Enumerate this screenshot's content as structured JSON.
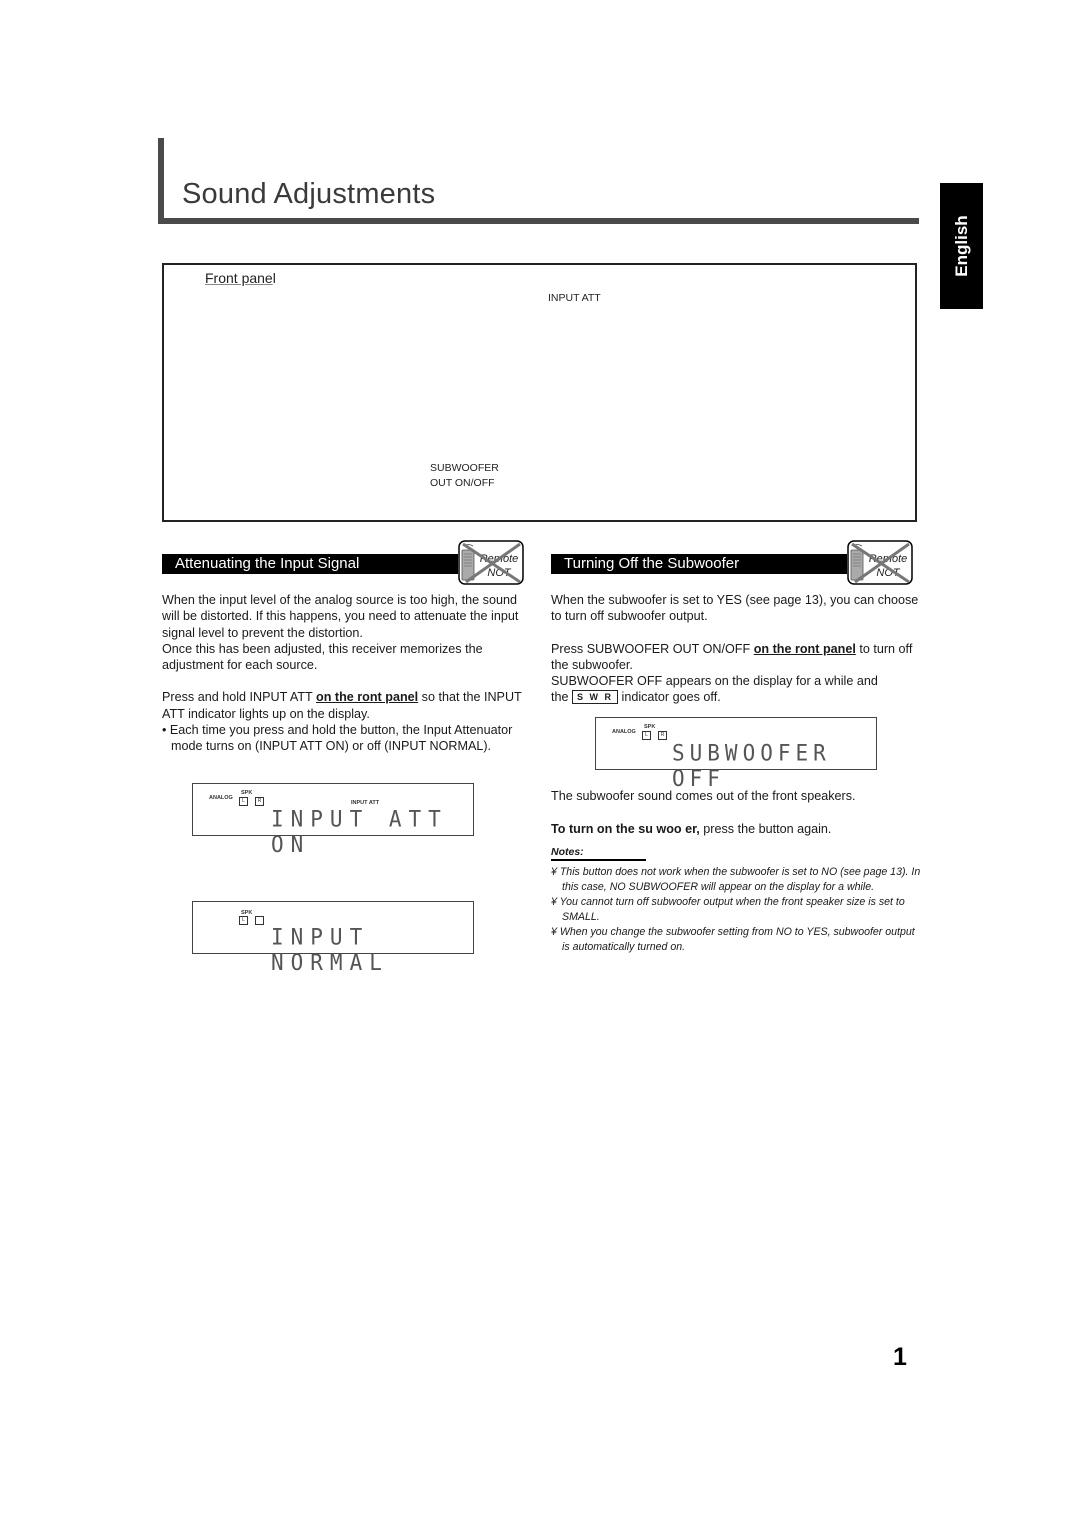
{
  "page": {
    "title": "Sound Adjustments",
    "language_tab": "English",
    "page_number": "1"
  },
  "front_panel": {
    "label_underlined": "Front pane",
    "label_rest": "l",
    "callouts": {
      "input_att": "INPUT ATT",
      "subwoofer_line1": "SUBWOOFER",
      "subwoofer_line2": "OUT ON/OFF"
    }
  },
  "remote_badge": {
    "icon": "remote-not-icon",
    "line1": "Remote",
    "line2": "NOT"
  },
  "attenuating": {
    "header": "Attenuating the Input Signal",
    "para1": "When the input level of the analog source is too high, the sound will be distorted. If this happens, you need to attenuate the input signal level to prevent the distortion.",
    "para2": "Once this has been adjusted, this receiver memorizes the adjustment for each source.",
    "instr_pre": "Press and hold INPUT ATT ",
    "instr_bold": "on the  ront panel",
    "instr_post": " so that the INPUT ATT indicator lights up on the display.",
    "bullet": "• Each time you press and hold the button, the Input Attenuator mode turns on (INPUT ATT ON) or off (INPUT NORMAL).",
    "display_on": {
      "analog": "ANALOG",
      "spk": "SPK",
      "spk_l": "L",
      "spk_r": "R",
      "indicator": "INPUT ATT",
      "text": "INPUT ATT ON"
    },
    "display_normal": {
      "spk": "SPK",
      "spk_l": "L",
      "text": "INPUT NORMAL"
    }
  },
  "subwoofer": {
    "header": "Turning Off the Subwoofer",
    "para1": "When the subwoofer is set to YES (see page 13), you can choose to turn off subwoofer output.",
    "instr_pre": "Press SUBWOOFER OUT ON/OFF ",
    "instr_bold": "on the  ront panel",
    "instr_post": " to turn off the subwoofer.",
    "instr2": "SUBWOOFER OFF appears on the display for a while and",
    "instr3_pre": "the ",
    "swr_indicator": "S W R",
    "instr3_post": "  indicator goes off.",
    "display_off": {
      "analog": "ANALOG",
      "spk": "SPK",
      "spk_l": "L",
      "spk_r": "R",
      "text": "SUBWOOFER OFF"
    },
    "result": "The subwoofer sound comes out of the front speakers.",
    "turn_on_bold": "To turn on the su  woo er,",
    "turn_on_rest": " press the button again.",
    "notes_title": "Notes:",
    "notes": [
      "¥ This button does not work when the subwoofer is set to  NO  (see page 13). In this case,  NO SUBWOOFER  will appear on the display for a while.",
      "¥ You cannot turn off subwoofer output when the front speaker size is set to  SMALL.",
      "¥ When you change the subwoofer setting from  NO  to  YES, subwoofer output is automatically turned on."
    ]
  }
}
